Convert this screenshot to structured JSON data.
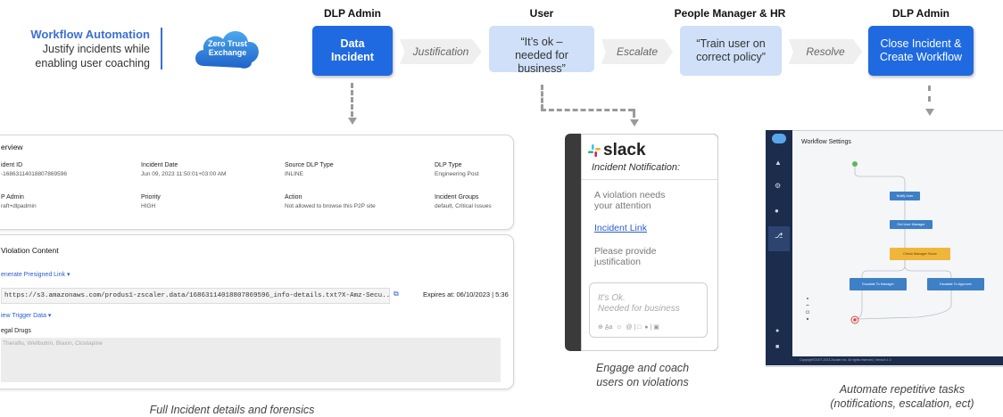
{
  "header": {
    "title": "Workflow Automation",
    "subtitle_line1": "Justify incidents while",
    "subtitle_line2": "enabling user coaching",
    "cloud_line1": "Zero Trust",
    "cloud_line2": "Exchange"
  },
  "flow": {
    "roles": [
      "DLP Admin",
      "User",
      "People Manager & HR",
      "DLP Admin"
    ],
    "steps": [
      {
        "line1": "Data",
        "line2": "Incident",
        "line3": ""
      },
      {
        "line1": "“It’s ok –",
        "line2": "needed for",
        "line3": "business”"
      },
      {
        "line1": "“Train user on",
        "line2": "correct policy”",
        "line3": ""
      },
      {
        "line1": "Close Incident &",
        "line2": "Create Workflow",
        "line3": ""
      }
    ],
    "transitions": [
      "Justification",
      "Escalate",
      "Resolve"
    ]
  },
  "incident": {
    "overview_title": "erview",
    "fields": [
      {
        "label": "ident ID",
        "value": "-16863114018807869596"
      },
      {
        "label": "Incident Date",
        "value": "Jun 09, 2023 11:50:01+03:00 AM"
      },
      {
        "label": "Source DLP Type",
        "value": "INLINE"
      },
      {
        "label": "DLP Type",
        "value": "Engineering Post"
      },
      {
        "label": "P Admin",
        "value": "raft+dlpadmin"
      },
      {
        "label": "Priority",
        "value": "HIGH"
      },
      {
        "label": "Action",
        "value": "Not allowed to browse this P2P site"
      },
      {
        "label": "Incident Groups",
        "value": "default, Critical Issues"
      }
    ],
    "violation_title": "Violation Content",
    "presigned_link": "enerate Presigned Link",
    "url": "https://s3.amazonaws.com/produs1-zscaler.data/16863114018807869596_info-details.txt?X-Amz-Secu...",
    "expires": "Expires at: 06/10/2023 | 5:36",
    "trigger_link": "iew Trigger Data",
    "trigger_label": "egal Drugs",
    "trigger_value": "Theraflu, Wellbutrin, Biaxin, Clostapine",
    "caption": "Full Incident details and forensics"
  },
  "slack": {
    "brand": "slack",
    "notification_title": "Incident Notification:",
    "message_line1": "A violation needs",
    "message_line2": "your attention",
    "link": "Incident Link",
    "prompt_line1": "Please provide",
    "prompt_line2": "justification",
    "reply_line1": "It's Ok.",
    "reply_line2": "Needed for business",
    "caption_line1": "Engage and coach",
    "caption_line2": "users on violations"
  },
  "workflow": {
    "title": "Workflow Settings",
    "nodes": [
      "Notify User",
      "Get User Manager",
      "Check Manager Score",
      "Escalate To Manager",
      "Escalate To Approver"
    ],
    "footer": "Copyright©2007-2023 Zscaler Inc. All rights reserved | Version 1.0",
    "caption_line1": "Automate repetitive tasks",
    "caption_line2": "(notifications, escalation, ect)"
  },
  "colors": {
    "accent": "#1f6ae0",
    "light_box": "#cfe0f8",
    "title_blue": "#3b6fd4",
    "node_gold": "#f0b63c"
  }
}
